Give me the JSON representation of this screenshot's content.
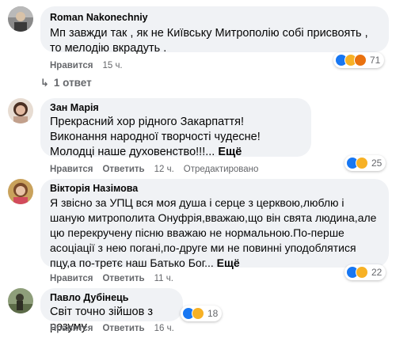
{
  "comments": [
    {
      "author": "Roman Nakonechniy",
      "text": "Мп завжди так , як не Київську Митрополію собі присвоять , то мелодію вкрадуть .",
      "more": "",
      "like": "Нравится",
      "reply": "",
      "time": "15 ч.",
      "edited": "",
      "reaction_count": "71",
      "reactions": [
        "like",
        "haha",
        "angry"
      ],
      "replies_label": "1 ответ"
    },
    {
      "author": "Зан Марія",
      "text": "Прекрасний хор рідного Закарпаття! Виконання народної творчості чудесне! Молодці наше духовенство!!!...",
      "more": "Ещё",
      "like": "Нравится",
      "reply": "Ответить",
      "time": "12 ч.",
      "edited": "Отредактировано",
      "reaction_count": "25",
      "reactions": [
        "like",
        "haha"
      ]
    },
    {
      "author": "Вікторія Назімова",
      "text": "Я звісно за УПЦ вся моя душа і серце з церквою,люблю і шаную митрополита Онуфрія,вважаю,що він свята людина,але цю перекручену пісню вважаю не нормальною.По-перше асоціації з нею погані,по-друге ми не повинні уподоблятися пцу,а по-третє наш Батько Бог...",
      "more": "Ещё",
      "like": "Нравится",
      "reply": "Ответить",
      "time": "11 ч.",
      "edited": "",
      "reaction_count": "22",
      "reactions": [
        "like",
        "haha"
      ]
    },
    {
      "author": "Павло Дубінець",
      "text": "Світ точно зійшов з розуму",
      "more": "",
      "like": "Нравится",
      "reply": "Ответить",
      "time": "16 ч.",
      "edited": "",
      "reaction_count": "18",
      "reactions": [
        "like",
        "sad"
      ]
    }
  ],
  "colors": {
    "bubble": "#f0f2f5",
    "meta_text": "#65676b",
    "like_blue": "#1877f2",
    "haha_yellow": "#f7b125",
    "angry_orange": "#e9710f"
  }
}
